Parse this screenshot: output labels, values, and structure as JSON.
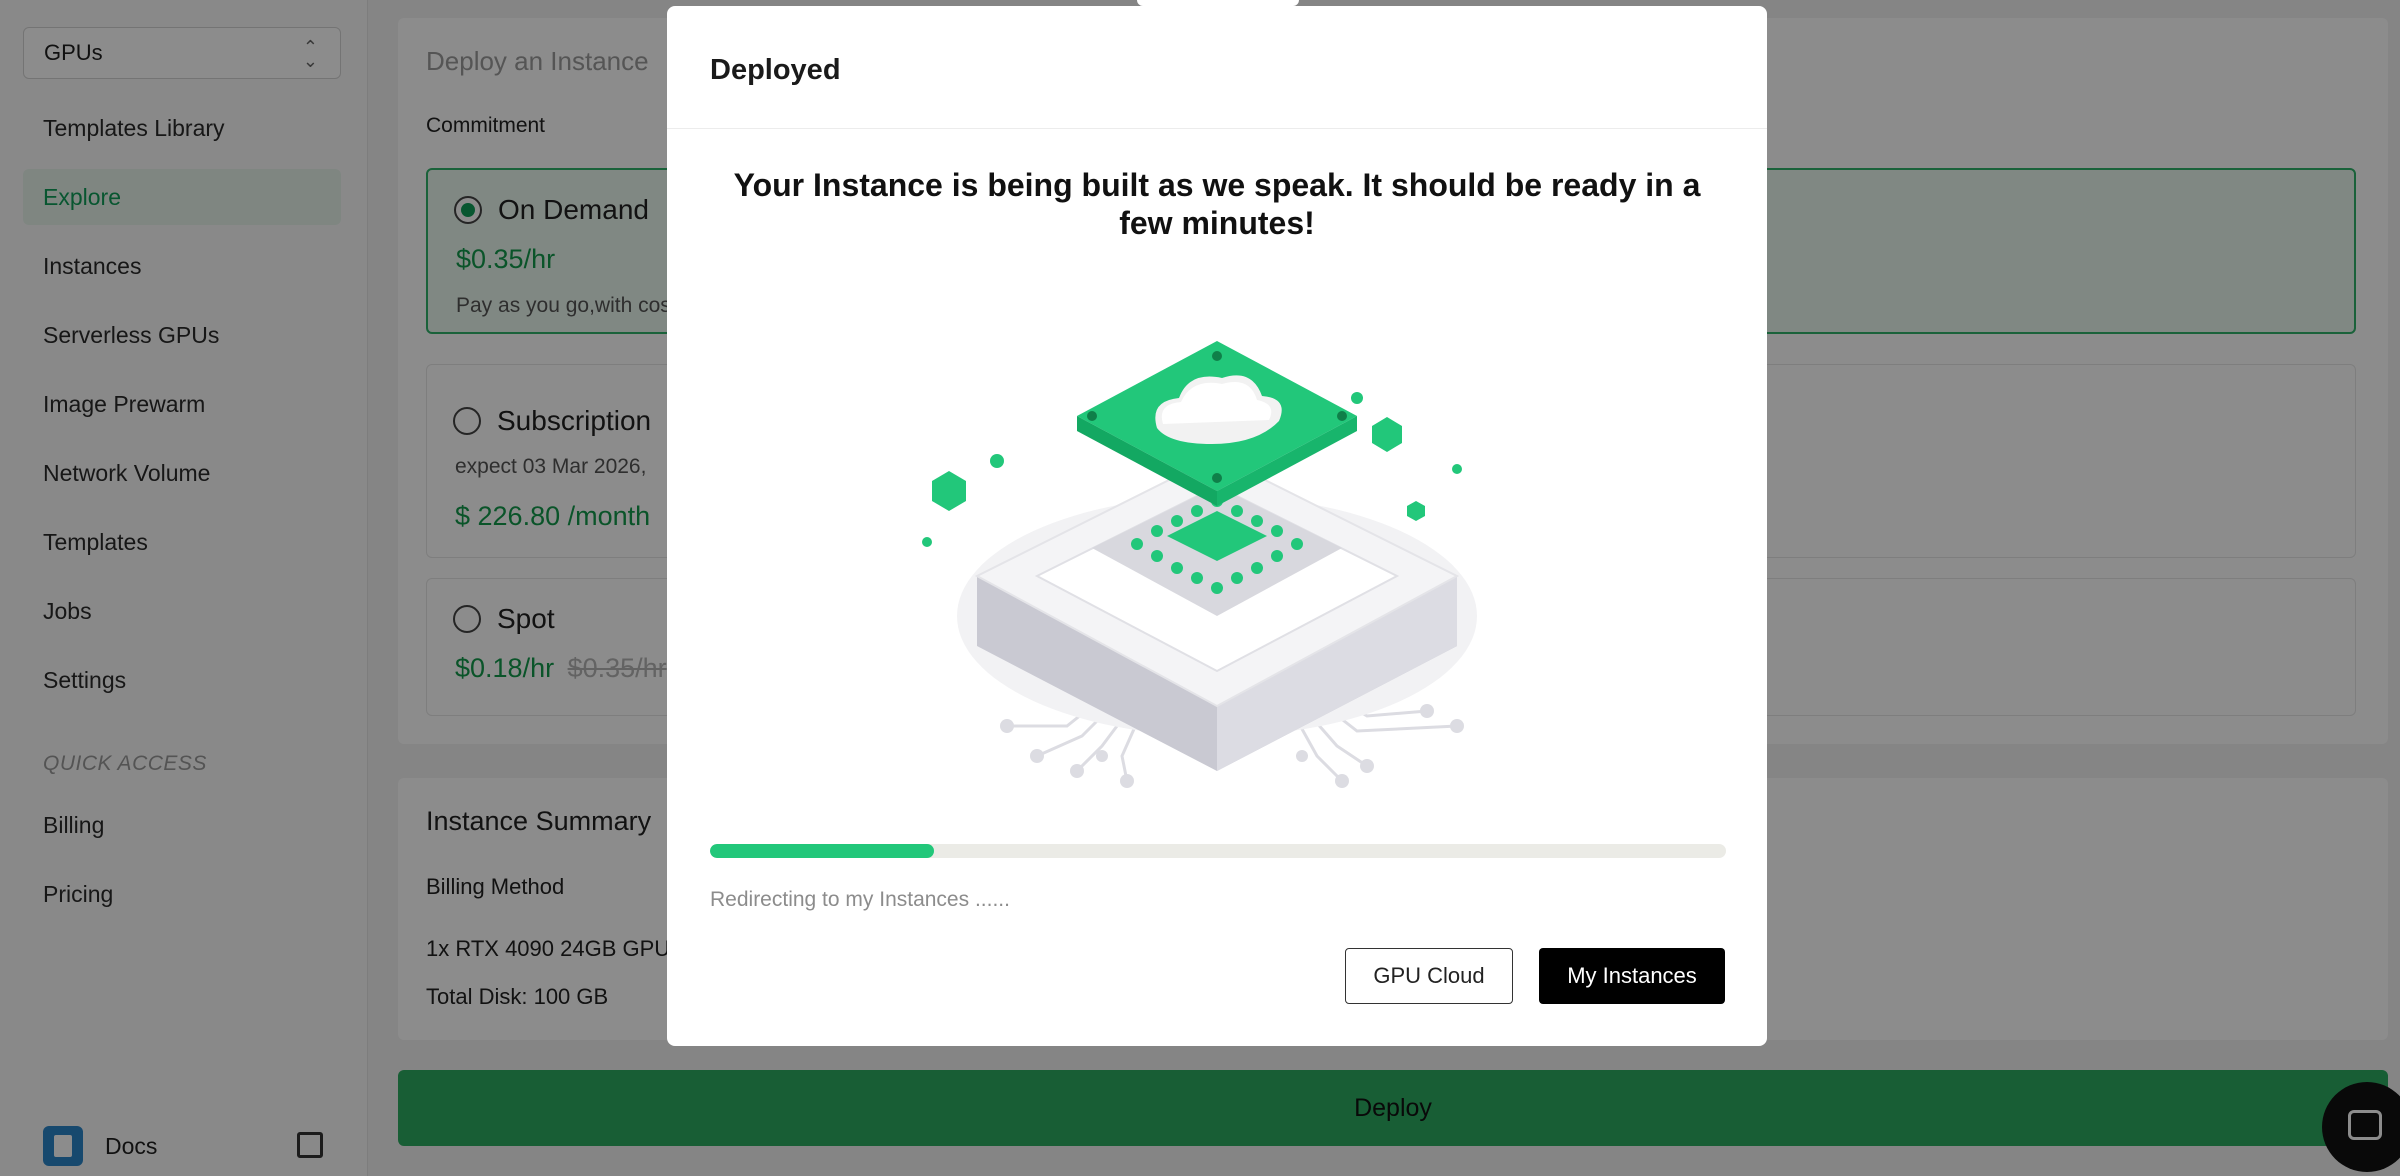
{
  "sidebar": {
    "select_value": "GPUs",
    "items": [
      {
        "label": "Templates Library"
      },
      {
        "label": "Explore"
      },
      {
        "label": "Instances"
      },
      {
        "label": "Serverless GPUs"
      },
      {
        "label": "Image Prewarm"
      },
      {
        "label": "Network Volume"
      },
      {
        "label": "Templates"
      },
      {
        "label": "Jobs"
      },
      {
        "label": "Settings"
      }
    ],
    "quick_access_label": "QUICK ACCESS",
    "quick_items": [
      {
        "label": "Billing"
      },
      {
        "label": "Pricing"
      }
    ],
    "docs_label": "Docs"
  },
  "main": {
    "title": "Deploy an Instance",
    "commitment_label": "Commitment",
    "options": [
      {
        "name": "On Demand",
        "price": "$0.35/hr",
        "desc": "Pay as you go,with cos"
      },
      {
        "name": "Subscription",
        "desc": "expect  03 Mar 2026,",
        "price": "$ 226.80 /month"
      },
      {
        "name": "Spot",
        "price": "$0.18/hr",
        "old_price": "$0.35/hr"
      }
    ],
    "summary": {
      "title": "Instance Summary",
      "billing_method": "Billing Method",
      "gpu": "1x RTX 4090 24GB GPU",
      "disk": "Total Disk: 100 GB"
    },
    "deploy_label": "Deploy"
  },
  "modal": {
    "title": "Deployed",
    "message": "Your Instance is being built as we speak. It should be ready in a few minutes!",
    "progress": 0.22,
    "redirect_text": "Redirecting to my Instances ......",
    "secondary_label": "GPU Cloud",
    "primary_label": "My Instances"
  },
  "colors": {
    "accent": "#0f9d58",
    "deploy_green": "#2dac62",
    "illustration_green": "#22c77a"
  }
}
